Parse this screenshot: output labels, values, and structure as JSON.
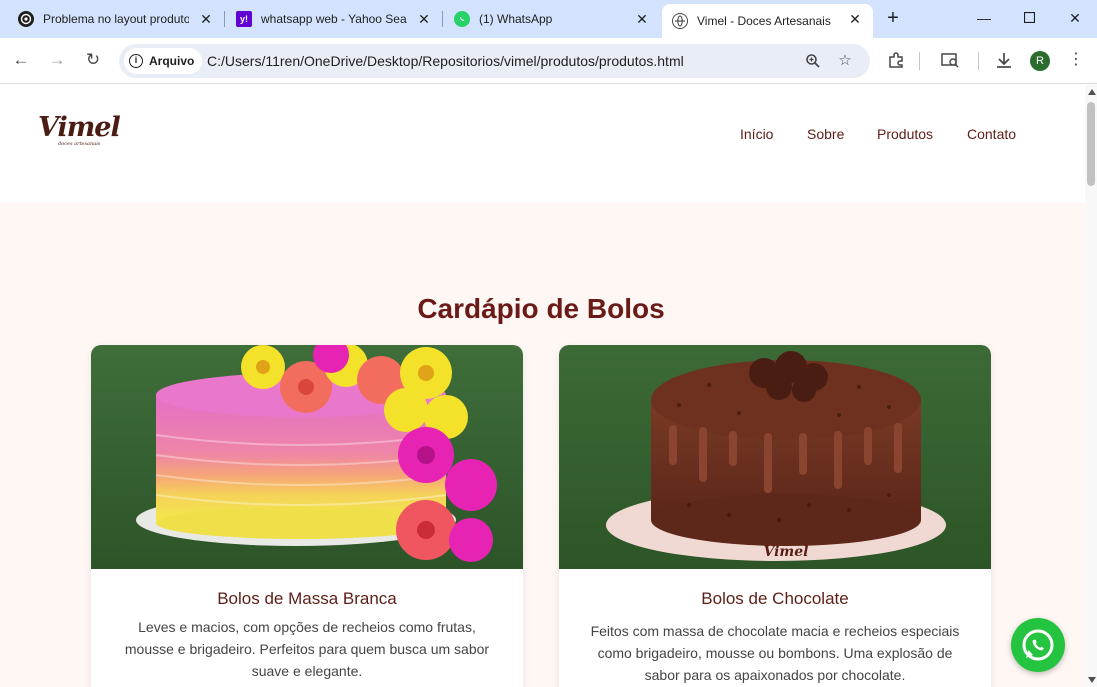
{
  "browser": {
    "tabs": [
      {
        "title": "Problema no layout produtos",
        "favicon": "github-icon"
      },
      {
        "title": "whatsapp web - Yahoo Search",
        "favicon": "yahoo-icon"
      },
      {
        "title": "(1) WhatsApp",
        "favicon": "whatsapp-icon"
      },
      {
        "title": "Vimel - Doces Artesanais",
        "favicon": "globe-icon",
        "active": true
      }
    ],
    "security_chip": "Arquivo",
    "url": "C:/Users/11ren/OneDrive/Desktop/Repositorios/vimel/produtos/produtos.html",
    "profile_initial": "R"
  },
  "site": {
    "logo": {
      "name": "Vimel",
      "tagline": "doces artesanais"
    },
    "nav": [
      "Início",
      "Sobre",
      "Produtos",
      "Contato"
    ],
    "page_title": "Cardápio de Bolos",
    "cards": [
      {
        "title": "Bolos de Massa Branca",
        "description": "Leves e macios, com opções de recheios como frutas, mousse e brigadeiro. Perfeitos para quem busca um sabor suave e elegante."
      },
      {
        "title": "Bolos de Chocolate",
        "description": "Feitos com massa de chocolate macia e recheios especiais como brigadeiro, mousse ou bombons. Uma explosão de sabor para os apaixonados por chocolate.",
        "image_text": "Vimel"
      }
    ]
  },
  "colors": {
    "brand": "#6b1b17",
    "section_bg": "#fff7f4",
    "whatsapp": "#25c440"
  }
}
